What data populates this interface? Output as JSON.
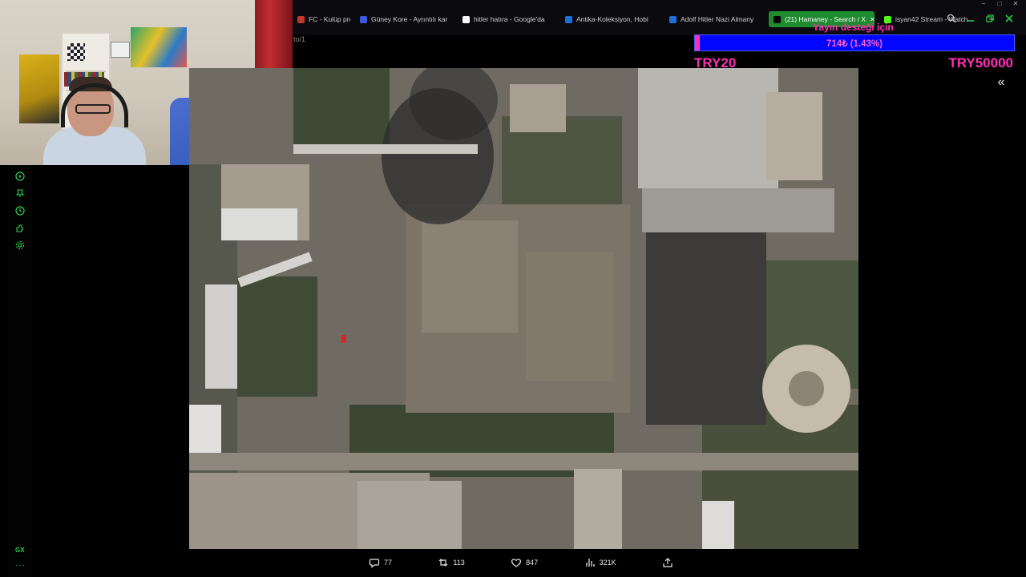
{
  "browser": {
    "tabs": [
      {
        "label": "FC - Kulüp pro",
        "favicon_color": "#c0392b",
        "active": false
      },
      {
        "label": "Güney Kore - Ayrıntılı kar",
        "favicon_color": "#3b5bdb",
        "active": false
      },
      {
        "label": "hitler hatıra - Google'da",
        "favicon_color": "#ffffff",
        "active": false
      },
      {
        "label": "Antika-Koleksiyon, Hobi",
        "favicon_color": "#1e6fd9",
        "active": false
      },
      {
        "label": "Adolf Hitler Nazi Almany",
        "favicon_color": "#1e6fd9",
        "active": false
      },
      {
        "label": "(21) Hamaney - Search / X",
        "favicon_color": "#000000",
        "active": true
      },
      {
        "label": "isyan42 Stream - Watch",
        "favicon_color": "#53fc18",
        "active": false
      }
    ],
    "new_tab_icon": "plus-icon",
    "url_fragment": "to/1",
    "toolbar_icons": [
      "search-icon",
      "minimize-icon",
      "restore-icon",
      "close-icon"
    ]
  },
  "donation": {
    "title": "Yayın desteği için",
    "progress_text": "714₺ (1.43%)",
    "progress_fraction": 0.0143,
    "min_label": "TRY20",
    "max_label": "TRY50000",
    "accent_color": "#ff2fb5",
    "bar_color": "#0006ff"
  },
  "sidebar": {
    "icons": [
      "player-icon",
      "pin-icon",
      "history-icon",
      "extensions-icon",
      "settings-icon"
    ],
    "gx_label": "GX",
    "more_label": "···"
  },
  "viewer": {
    "collapse_icon": "double-chevron-left-icon",
    "image_alt": "satellite-image"
  },
  "actions": {
    "replies": "77",
    "reposts": "113",
    "likes": "847",
    "views": "321K"
  }
}
